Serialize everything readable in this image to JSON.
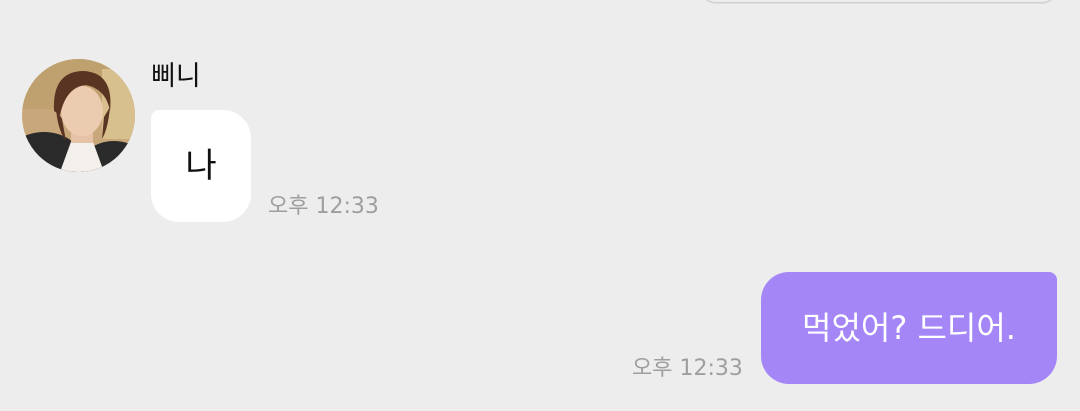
{
  "chat": {
    "incoming": {
      "sender_name": "삐니",
      "avatar": "profile-photo",
      "message": "나",
      "time": "오후 12:33"
    },
    "outgoing": {
      "message": "먹었어? 드디어.",
      "time": "오후 12:33"
    }
  },
  "colors": {
    "background": "#ededed",
    "incoming_bubble": "#ffffff",
    "outgoing_bubble": "#a586f7",
    "timestamp": "#9e9e9e"
  }
}
